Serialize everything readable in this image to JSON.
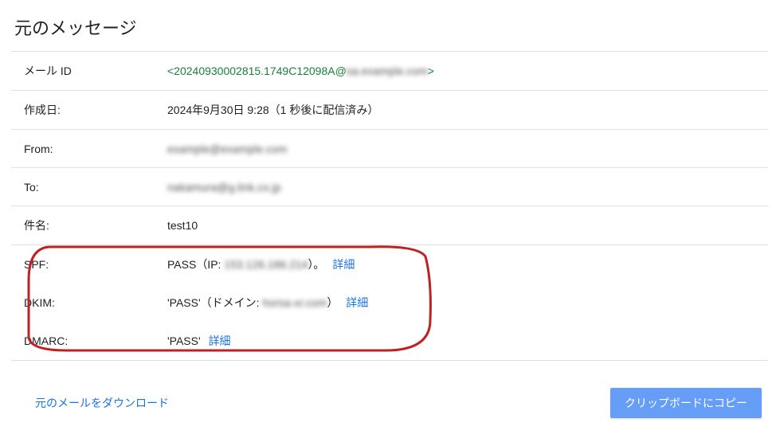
{
  "page_title": "元のメッセージ",
  "rows": {
    "message_id": {
      "label": "メール ID",
      "prefix": "<20240930002815.1749C12098A@",
      "hidden": "sa.example.com",
      "suffix": ">"
    },
    "created": {
      "label": "作成日:",
      "value": "2024年9月30日 9:28（1 秒後に配信済み）"
    },
    "from": {
      "label": "From:",
      "value": "example@example.com"
    },
    "to": {
      "label": "To:",
      "value": "nakamura@g.link.co.jp"
    },
    "subject": {
      "label": "件名:",
      "value": "test10"
    },
    "spf": {
      "label": "SPF:",
      "value_pre": "PASS（IP: ",
      "hidden": "153.126.186.214",
      "value_post": "）。",
      "link": "詳細"
    },
    "dkim": {
      "label": "DKIM:",
      "value_pre": "'PASS'（ドメイン: ",
      "hidden": "horsa-xr.com",
      "value_post": "）",
      "link": "詳細"
    },
    "dmarc": {
      "label": "DMARC:",
      "value": "'PASS'",
      "link": "詳細"
    }
  },
  "actions": {
    "download_original": "元のメールをダウンロード",
    "copy_clipboard": "クリップボードにコピー"
  }
}
